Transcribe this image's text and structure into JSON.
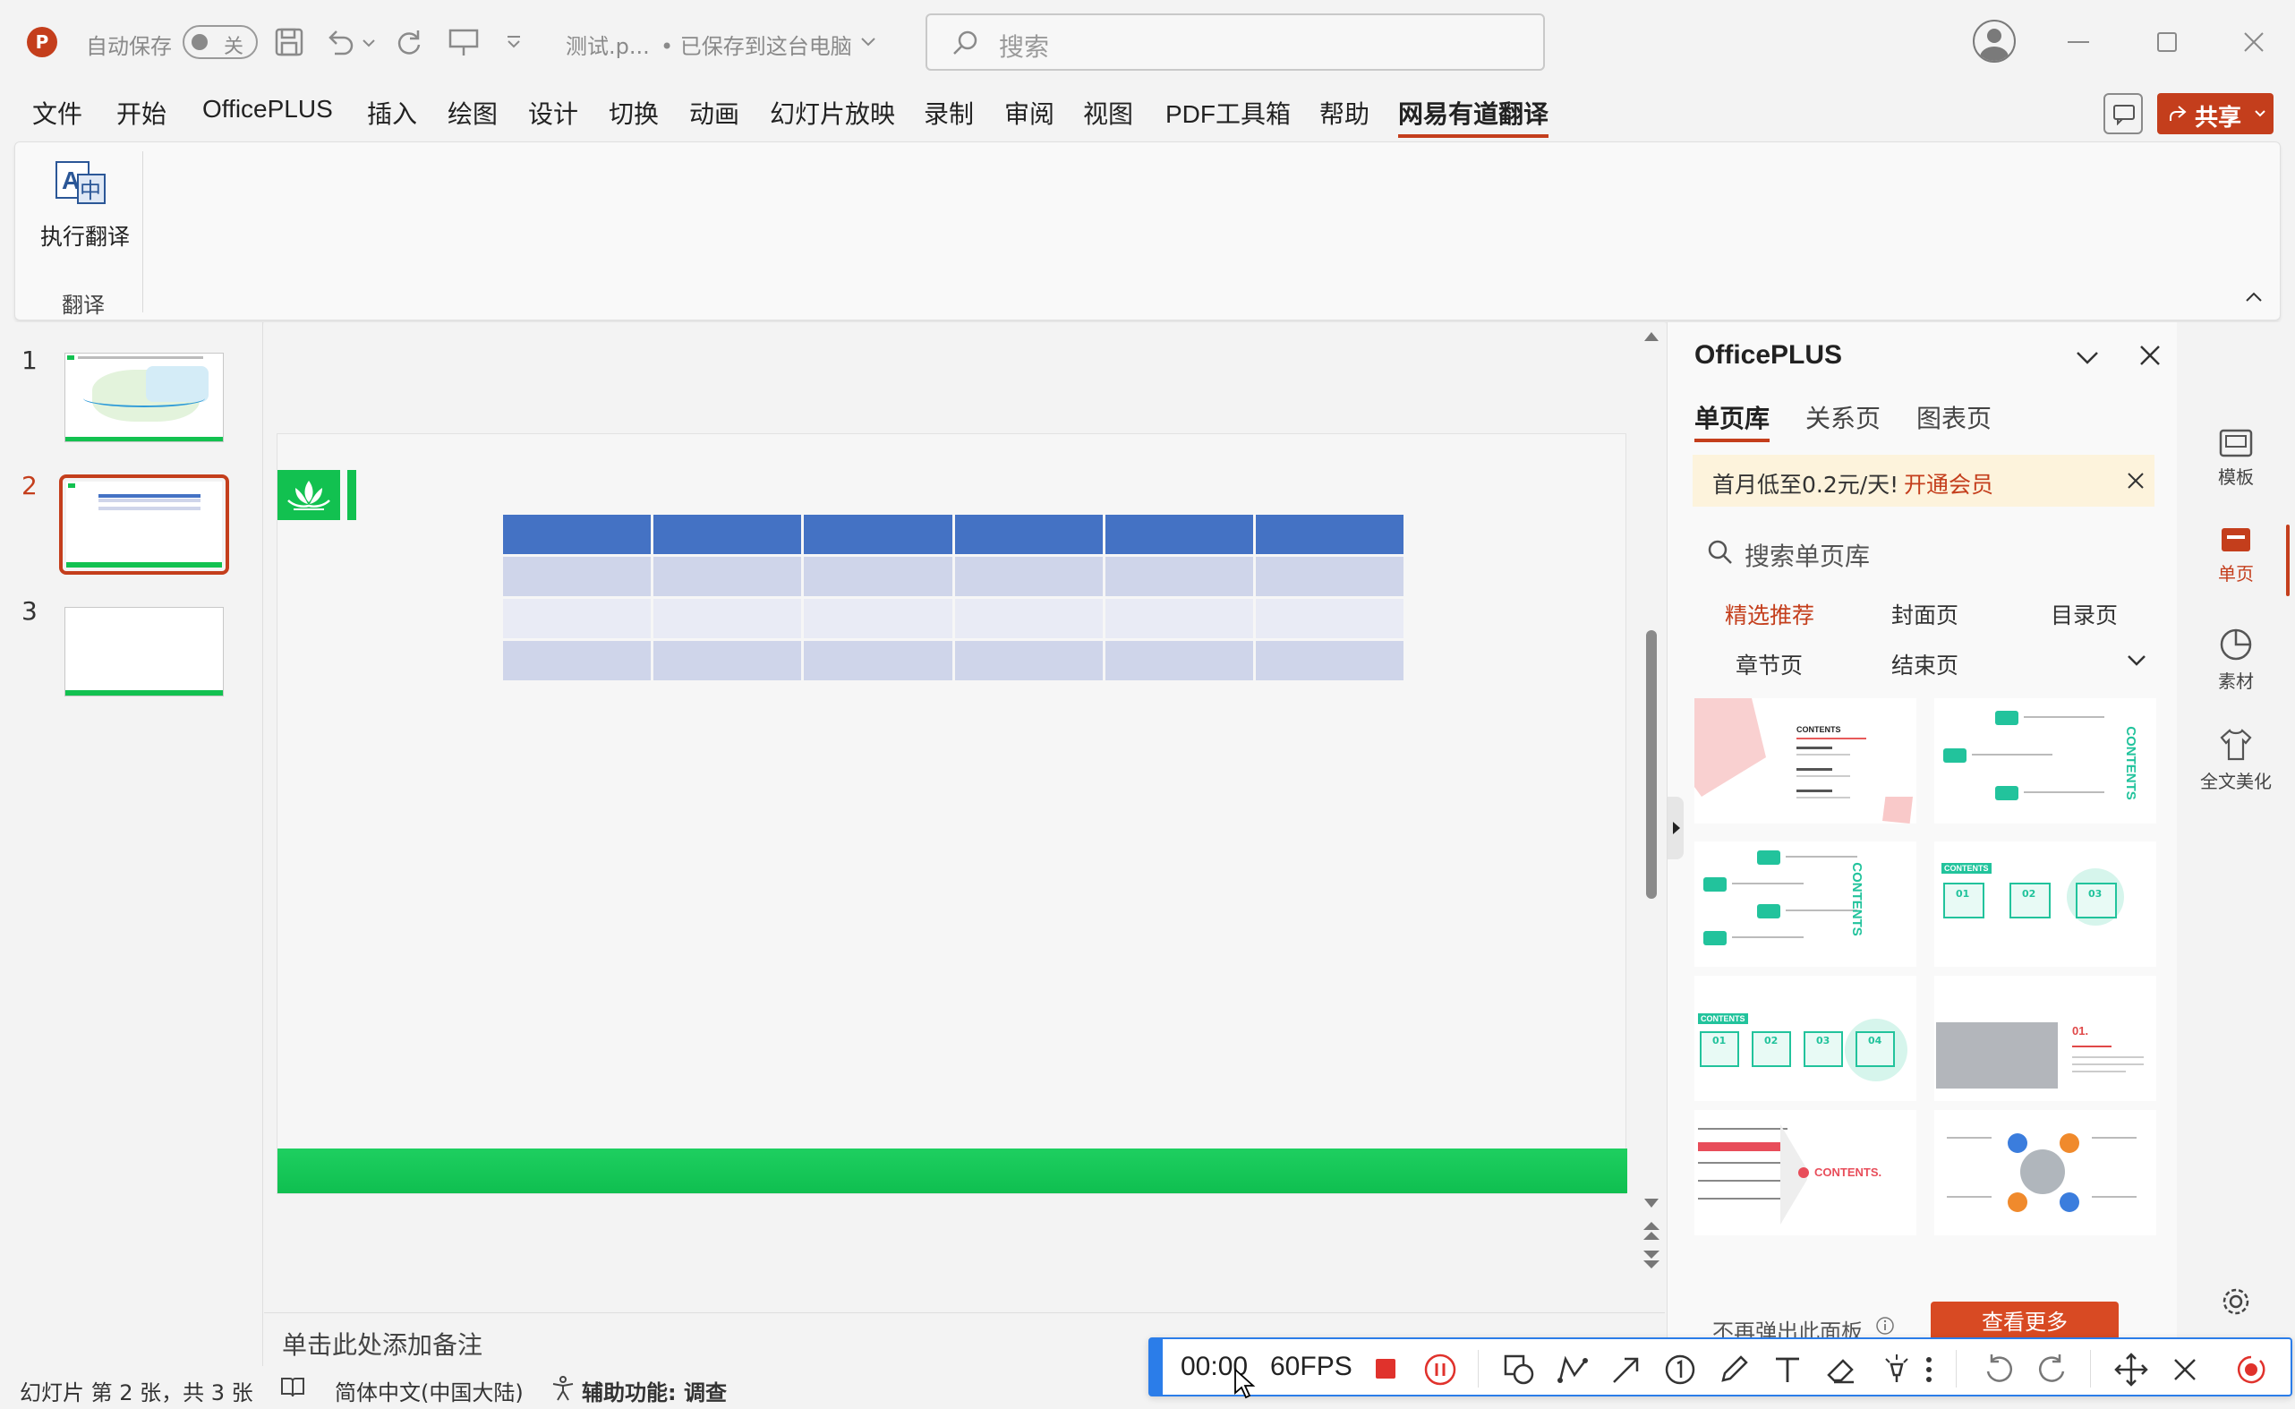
{
  "titlebar": {
    "autosave_label": "自动保存",
    "autosave_state": "关",
    "doc_name": "测试.p...",
    "save_status": "• 已保存到这台电脑",
    "search_placeholder": "搜索"
  },
  "menu": {
    "items": [
      "文件",
      "开始",
      "OfficePLUS",
      "插入",
      "绘图",
      "设计",
      "切换",
      "动画",
      "幻灯片放映",
      "录制",
      "审阅",
      "视图",
      "PDF工具箱",
      "帮助",
      "网易有道翻译"
    ],
    "active": "网易有道翻译",
    "share_label": "共享"
  },
  "ribbon": {
    "button_label": "执行翻译",
    "group_label": "翻译"
  },
  "slides": {
    "numbers": [
      "1",
      "2",
      "3"
    ],
    "selected": "2"
  },
  "notes_placeholder": "单击此处添加备注",
  "officeplus": {
    "title": "OfficePLUS",
    "tabs": [
      "单页库",
      "关系页",
      "图表页"
    ],
    "active_tab": "单页库",
    "promo_text": "首月低至0.2元/天!",
    "promo_link": "开通会员",
    "search_placeholder": "搜索单页库",
    "categories": [
      "精选推荐",
      "封面页",
      "目录页",
      "章节页",
      "结束页"
    ],
    "active_category": "精选推荐",
    "dont_show": "不再弹出此面板",
    "more_button": "查看更多",
    "card_texts": {
      "contents_upper": "CONTENTS",
      "contents_dot": "CONTENTS.",
      "num_01": "01.",
      "n01": "01",
      "n02": "02",
      "n03": "03",
      "n04": "04"
    }
  },
  "rail": {
    "items": [
      "模板",
      "单页",
      "素材",
      "全文美化"
    ],
    "active": "单页"
  },
  "statusbar": {
    "slide_info": "幻灯片 第 2 张，共 3 张",
    "language": "简体中文(中国大陆)",
    "accessibility": "辅助功能: 调查"
  },
  "recorder": {
    "time": "00:00",
    "fps": "60FPS"
  },
  "colors": {
    "accent_red": "#c43e1c",
    "table_header": "#4472c4",
    "table_row": "#cfd5ea",
    "slide_green": "#12c150",
    "recorder_blue": "#2b7de9"
  }
}
